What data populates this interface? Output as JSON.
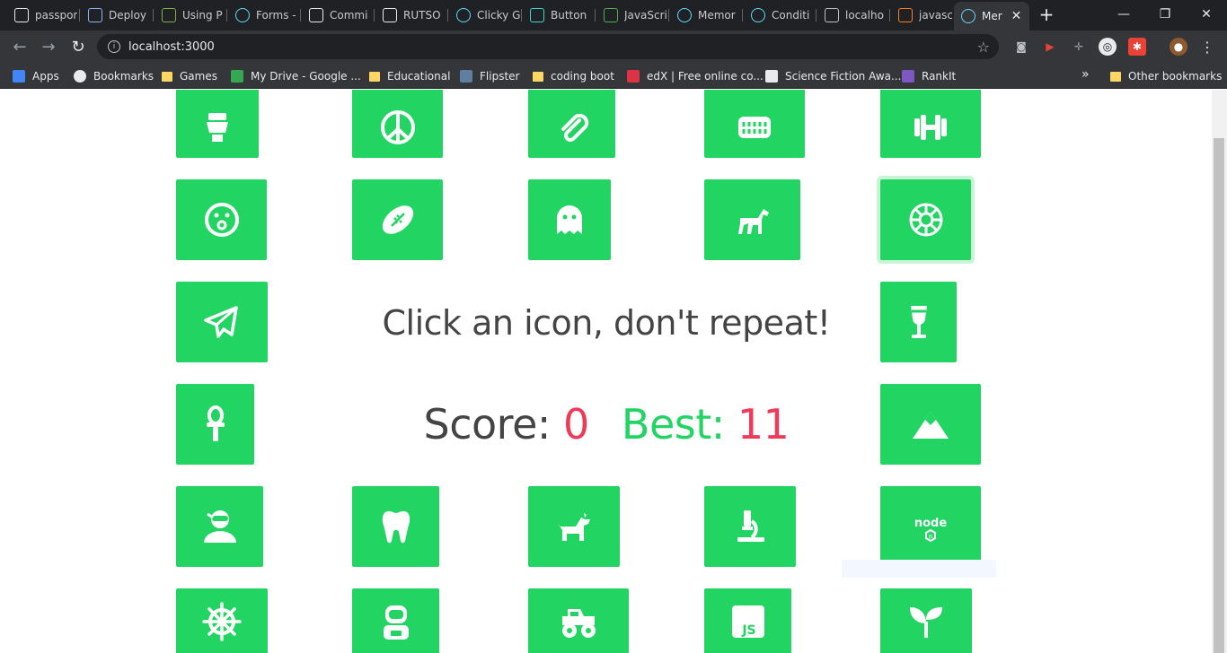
{
  "browser": {
    "tabs": [
      {
        "title": "passpor",
        "icon": "passport-icon",
        "color": "#e8eaed"
      },
      {
        "title": "Deploy",
        "icon": "dc-icon",
        "color": "#8ab4f8"
      },
      {
        "title": "Using P",
        "icon": "leaf-icon",
        "color": "#7cb342"
      },
      {
        "title": "Forms -",
        "icon": "react-icon",
        "color": "#61dafb"
      },
      {
        "title": "Commi",
        "icon": "github-icon",
        "color": "#e8eaed"
      },
      {
        "title": "RUTSO",
        "icon": "github-icon",
        "color": "#e8eaed"
      },
      {
        "title": "Clicky G",
        "icon": "react-icon",
        "color": "#61dafb"
      },
      {
        "title": "Button",
        "icon": "codepen-icon",
        "color": "#3dd6d0"
      },
      {
        "title": "JavaScri",
        "icon": "w3-icon",
        "color": "#4caf50"
      },
      {
        "title": "Memor",
        "icon": "react-icon",
        "color": "#61dafb"
      },
      {
        "title": "Conditi",
        "icon": "react-icon",
        "color": "#61dafb"
      },
      {
        "title": "localho",
        "icon": "page-icon",
        "color": "#bdc1c6"
      },
      {
        "title": "javascri",
        "icon": "stackoverflow-icon",
        "color": "#f48024"
      },
      {
        "title": "Mer",
        "icon": "react-icon",
        "color": "#61dafb",
        "active": true
      }
    ],
    "new_tab": "+",
    "window_controls": {
      "minimize": "—",
      "maximize": "❐",
      "close": "✕"
    },
    "url": "localhost:3000",
    "bookmarks": [
      {
        "label": "Apps",
        "icon": "apps-icon"
      },
      {
        "label": "Bookmarks",
        "icon": "star-icon"
      },
      {
        "label": "Games",
        "icon": "folder-icon"
      },
      {
        "label": "My Drive - Google ...",
        "icon": "drive-icon"
      },
      {
        "label": "Educational",
        "icon": "folder-icon"
      },
      {
        "label": "Flipster",
        "icon": "flipster-icon"
      },
      {
        "label": "coding boot",
        "icon": "folder-icon"
      },
      {
        "label": "edX | Free online co...",
        "icon": "edx-icon"
      },
      {
        "label": "Science Fiction Awa...",
        "icon": "page-icon"
      },
      {
        "label": "RankIt",
        "icon": "fv-icon"
      }
    ],
    "bookmarks_overflow": "»",
    "other_bookmarks": "Other bookmarks"
  },
  "game": {
    "instruction": "Click an icon, don't repeat!",
    "score_label": "Score:",
    "score": "0",
    "best_label": "Best:",
    "best": "11",
    "icons": [
      "toilet-icon",
      "peace-icon",
      "paperclip-icon",
      "teeth-icon",
      "dumbbell-icon",
      "surprise-face-icon",
      "football-icon",
      "ghost-icon",
      "horse-icon",
      "galactic-empire-icon",
      "paper-plane-icon",
      "wine-glass-icon",
      "ankh-icon",
      "mountain-icon",
      "user-ninja-icon",
      "tooth-icon",
      "dog-icon",
      "microscope-icon",
      "nodejs-icon",
      "ship-wheel-icon",
      "astronaut-icon",
      "monster-truck-icon",
      "js-square-icon",
      "seedling-icon"
    ],
    "hovered_icon": "galactic-empire-icon",
    "colors": {
      "card": "#22d462",
      "score_value": "#ef3b5a",
      "best_label": "#22d462",
      "text": "#444444"
    }
  }
}
